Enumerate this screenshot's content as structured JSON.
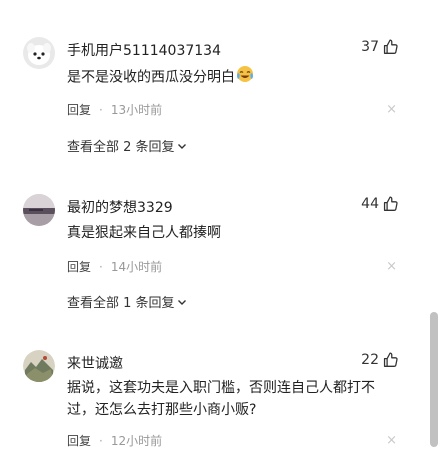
{
  "comments": [
    {
      "username": "手机用户51114037134",
      "likes": "37",
      "text": "是不是没收的西瓜没分明白",
      "emoji": "crying-laughing-emoji",
      "reply_label": "回复",
      "separator": "·",
      "time": "13小时前",
      "close": "×",
      "view_replies": "查看全部 2 条回复"
    },
    {
      "username": "最初的梦想3329",
      "likes": "44",
      "text": "真是狠起来自己人都揍啊",
      "reply_label": "回复",
      "separator": "·",
      "time": "14小时前",
      "close": "×",
      "view_replies": "查看全部 1 条回复"
    },
    {
      "username": "来世诚邀",
      "likes": "22",
      "text": "据说，这套功夫是入职门槛，否则连自己人都打不过，还怎么去打那些小商小贩?",
      "reply_label": "回复",
      "separator": "·",
      "time": "12小时前",
      "close": "×"
    }
  ],
  "colors": {
    "text": "#222222",
    "secondary": "#999999",
    "scrollbar": "#c1c1c1"
  }
}
